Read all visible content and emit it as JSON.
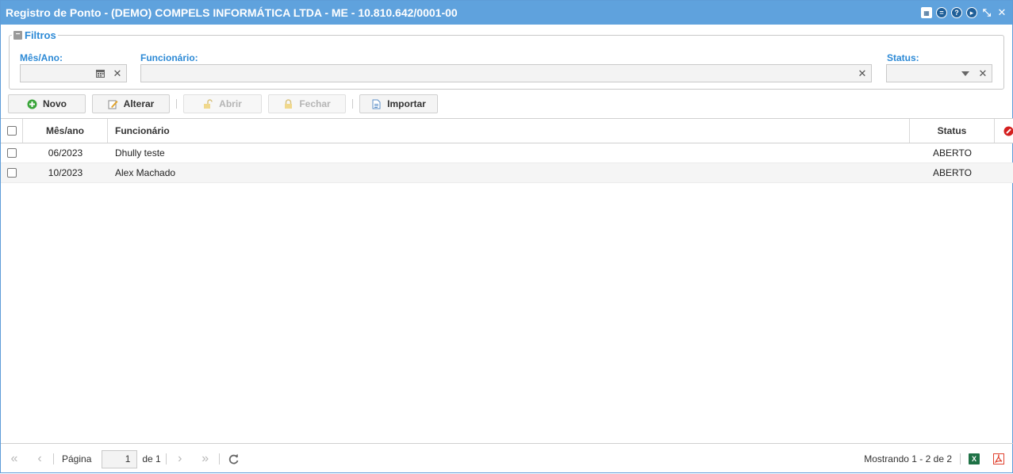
{
  "window": {
    "title": "Registro de Ponto - (DEMO) COMPELS INFORMÁTICA LTDA - ME - 10.810.642/0001-00"
  },
  "filters": {
    "legend": "Filtros",
    "mes_ano_label": "Mês/Ano:",
    "mes_ano_value": "",
    "funcionario_label": "Funcionário:",
    "funcionario_value": "",
    "status_label": "Status:",
    "status_value": ""
  },
  "toolbar": {
    "novo": "Novo",
    "alterar": "Alterar",
    "abrir": "Abrir",
    "fechar": "Fechar",
    "importar": "Importar"
  },
  "grid": {
    "columns": {
      "mes_ano": "Mês/ano",
      "funcionario": "Funcionário",
      "status": "Status"
    },
    "rows": [
      {
        "mes_ano": "06/2023",
        "funcionario": "Dhully teste",
        "status": "ABERTO"
      },
      {
        "mes_ano": "10/2023",
        "funcionario": "Alex Machado",
        "status": "ABERTO"
      }
    ]
  },
  "pager": {
    "page_label": "Página",
    "page_value": "1",
    "of_label": "de 1",
    "summary": "Mostrando 1 - 2 de 2"
  },
  "colors": {
    "titlebar": "#5fa2dd",
    "label_blue": "#2d8ad6",
    "excel_green": "#1e7145",
    "pdf_red": "#e0422f"
  }
}
